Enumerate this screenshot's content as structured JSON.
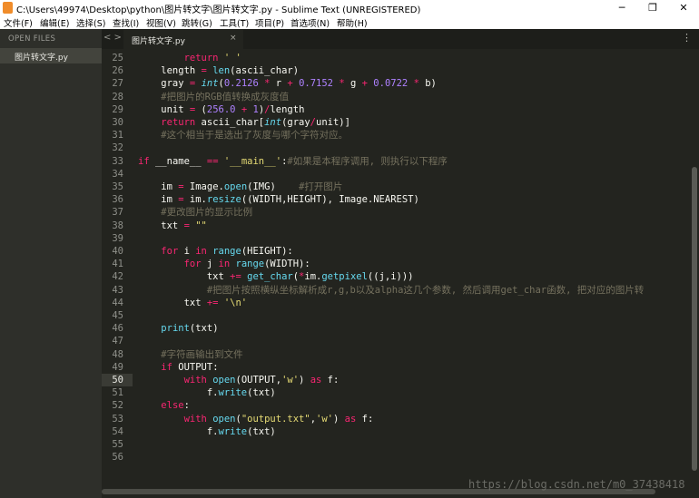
{
  "window": {
    "title": "C:\\Users\\49974\\Desktop\\python\\图片转文字\\图片转文字.py - Sublime Text (UNREGISTERED)",
    "minimize": "─",
    "maximize": "❐",
    "close": "✕"
  },
  "menu": [
    "文件(F)",
    "编辑(E)",
    "选择(S)",
    "查找(I)",
    "视图(V)",
    "跳转(G)",
    "工具(T)",
    "项目(P)",
    "首选项(N)",
    "帮助(H)"
  ],
  "sidebar": {
    "header": "OPEN FILES",
    "file": "图片转文字.py"
  },
  "tab": {
    "label": "图片转文字.py",
    "close": "×",
    "nav": "< >"
  },
  "editor": {
    "current_line": 50,
    "lines": [
      {
        "n": "25",
        "code": "        <span class=\"kw\">return</span> <span class=\"str\">' '</span>"
      },
      {
        "n": "26",
        "code": "    length <span class=\"op\">=</span> <span class=\"fn\">len</span>(ascii_char)"
      },
      {
        "n": "27",
        "code": "    gray <span class=\"op\">=</span> <span class=\"it\">int</span>(<span class=\"num\">0.2126</span> <span class=\"op\">*</span> r <span class=\"op\">+</span> <span class=\"num\">0.7152</span> <span class=\"op\">*</span> g <span class=\"op\">+</span> <span class=\"num\">0.0722</span> <span class=\"op\">*</span> b)"
      },
      {
        "n": "28",
        "code": "    <span class=\"cm\">#把图片的RGB值转换成灰度值</span>"
      },
      {
        "n": "29",
        "code": "    unit <span class=\"op\">=</span> (<span class=\"num\">256.0</span> <span class=\"op\">+</span> <span class=\"num\">1</span>)<span class=\"op\">/</span>length"
      },
      {
        "n": "30",
        "code": "    <span class=\"kw\">return</span> ascii_char[<span class=\"it\">int</span>(gray<span class=\"op\">/</span>unit)]"
      },
      {
        "n": "31",
        "code": "    <span class=\"cm\">#这个相当于是选出了灰度与哪个字符对应。</span>"
      },
      {
        "n": "32",
        "code": ""
      },
      {
        "n": "33",
        "code": "<span class=\"kw\">if</span> __name__ <span class=\"op\">==</span> <span class=\"str\">'__main__'</span>:<span class=\"cm\">#如果是本程序调用, 则执行以下程序</span>"
      },
      {
        "n": "34",
        "code": ""
      },
      {
        "n": "35",
        "code": "    im <span class=\"op\">=</span> Image.<span class=\"fn\">open</span>(IMG)    <span class=\"cm\">#打开图片</span>"
      },
      {
        "n": "36",
        "code": "    im <span class=\"op\">=</span> im.<span class=\"fn\">resize</span>((WIDTH,HEIGHT), Image.NEAREST)"
      },
      {
        "n": "37",
        "code": "    <span class=\"cm\">#更改图片的显示比例</span>"
      },
      {
        "n": "38",
        "code": "    txt <span class=\"op\">=</span> <span class=\"str\">\"\"</span>"
      },
      {
        "n": "39",
        "code": ""
      },
      {
        "n": "40",
        "code": "    <span class=\"kw\">for</span> i <span class=\"kw\">in</span> <span class=\"fn\">range</span>(HEIGHT):"
      },
      {
        "n": "41",
        "code": "        <span class=\"kw\">for</span> j <span class=\"kw\">in</span> <span class=\"fn\">range</span>(WIDTH):"
      },
      {
        "n": "42",
        "code": "            txt <span class=\"op\">+=</span> <span class=\"fn\">get_char</span>(<span class=\"op\">*</span>im.<span class=\"fn\">getpixel</span>((j,i)))"
      },
      {
        "n": "43",
        "code": "            <span class=\"cm\">#把图片按照横纵坐标解析成r,g,b以及alpha这几个参数, 然后调用get_char函数, 把对应的图片转</span>"
      },
      {
        "n": "44",
        "code": "        txt <span class=\"op\">+=</span> <span class=\"str\">'\\n'</span>"
      },
      {
        "n": "45",
        "code": ""
      },
      {
        "n": "46",
        "code": "    <span class=\"fn\">print</span>(txt)"
      },
      {
        "n": "47",
        "code": ""
      },
      {
        "n": "48",
        "code": "    <span class=\"cm\">#字符画输出到文件</span>"
      },
      {
        "n": "49",
        "code": "    <span class=\"kw\">if</span> OUTPUT:"
      },
      {
        "n": "50",
        "code": "        <span class=\"kw\">with</span> <span class=\"fn\">open</span>(OUTPUT,<span class=\"str\">'w'</span>) <span class=\"kw\">as</span> f:"
      },
      {
        "n": "51",
        "code": "            f.<span class=\"fn\">write</span>(txt)"
      },
      {
        "n": "52",
        "code": "    <span class=\"kw\">else</span>:"
      },
      {
        "n": "53",
        "code": "        <span class=\"kw\">with</span> <span class=\"fn\">open</span>(<span class=\"str\">\"output.txt\"</span>,<span class=\"str\">'w'</span>) <span class=\"kw\">as</span> f:"
      },
      {
        "n": "54",
        "code": "            f.<span class=\"fn\">write</span>(txt)"
      },
      {
        "n": "55",
        "code": ""
      },
      {
        "n": "56",
        "code": ""
      }
    ]
  },
  "watermark": "https://blog.csdn.net/m0_37438418",
  "colors": {
    "background": "#23241f",
    "keyword": "#f92672",
    "function": "#66d9ef",
    "number": "#ae81ff",
    "string": "#e6db74",
    "comment": "#75715e"
  }
}
